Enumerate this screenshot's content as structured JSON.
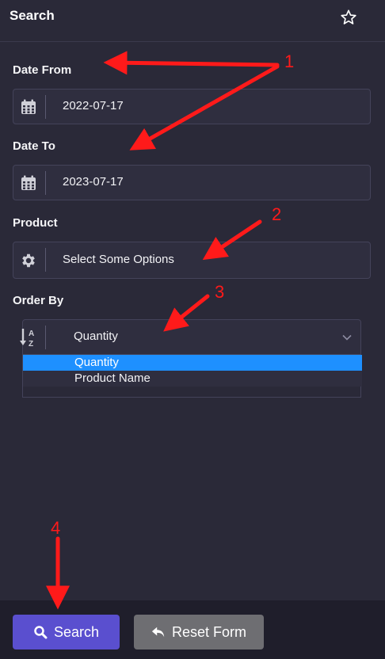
{
  "header": {
    "title": "Search",
    "favorite_icon": "star-icon"
  },
  "form": {
    "date_from": {
      "label": "Date From",
      "value": "2022-07-17",
      "icon": "calendar-icon"
    },
    "date_to": {
      "label": "Date To",
      "value": "2023-07-17",
      "icon": "calendar-icon"
    },
    "product": {
      "label": "Product",
      "placeholder": "Select Some Options",
      "icon": "gear-icon"
    },
    "order_by": {
      "label": "Order By",
      "selected": "Quantity",
      "icon": "sort-alpha-icon",
      "options": [
        "Quantity",
        "Product Name"
      ]
    }
  },
  "footer": {
    "search_label": "Search",
    "reset_label": "Reset Form"
  },
  "annotations": {
    "color": "#ff1a1a",
    "numbers": [
      "1",
      "2",
      "3",
      "4"
    ]
  },
  "colors": {
    "background": "#2a2938",
    "field": "#2f2e3f",
    "search_button": "#5a4fcf",
    "reset_button": "#6e6e72",
    "option_highlight": "#1e90ff"
  }
}
